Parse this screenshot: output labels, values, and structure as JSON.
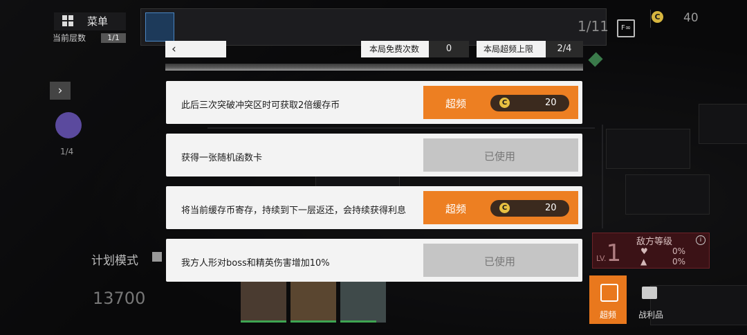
{
  "hud": {
    "menu_label": "菜单",
    "floor_label": "当前层数",
    "floor_value": "1/1",
    "progress": "1/11",
    "coins": "40",
    "doll_count": "1/4",
    "plan_mode_label": "计划模式",
    "power": "13700",
    "exit_label": "F∞",
    "coin_symbol": "C"
  },
  "enemy": {
    "level_prefix": "LV.",
    "level": "1",
    "title": "敌方等级",
    "info_symbol": "i",
    "hp_bonus": "0%",
    "atk_bonus": "0%"
  },
  "tabs": {
    "overclock_label": "超频",
    "loot_label": "战利品"
  },
  "modal": {
    "back_symbol": "‹",
    "free_label": "本局免费次数",
    "free_value": "0",
    "limit_label": "本局超频上限",
    "limit_value": "2/4",
    "options": [
      {
        "text": "此后三次突破冲突区时可获取2倍缓存币",
        "state": "available",
        "action_label": "超频",
        "cost": "20"
      },
      {
        "text": "获得一张随机函数卡",
        "state": "used",
        "action_label": "已使用"
      },
      {
        "text": "将当前缓存币寄存，持续到下一层返还，会持续获得利息",
        "state": "available",
        "action_label": "超频",
        "cost": "20"
      },
      {
        "text": "我方人形对boss和精英伤害增加10%",
        "state": "used",
        "action_label": "已使用"
      }
    ]
  },
  "colors": {
    "accent_orange": "#ed7f22",
    "used_grey": "#c5c5c5",
    "coin_gold": "#e7c041"
  }
}
